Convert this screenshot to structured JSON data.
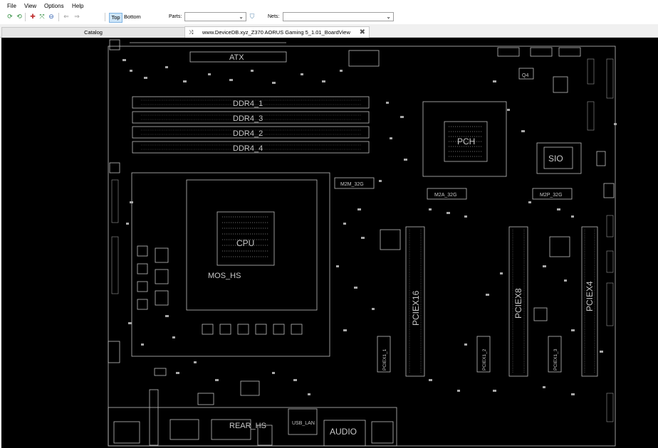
{
  "menu": [
    "File",
    "View",
    "Options",
    "Help"
  ],
  "toolbar": {
    "icons": [
      "refresh-icon",
      "expand-icon",
      "zoom-in-icon",
      "fit-icon",
      "zoom-out-icon",
      "back-arrow-icon",
      "forward-arrow-icon"
    ],
    "top_label": "Top",
    "bottom_label": "Bottom",
    "parts_label": "Parts:",
    "nets_label": "Nets:",
    "parts_value": "",
    "nets_value": ""
  },
  "tabs": {
    "catalog": "Catalog",
    "document": "www.DeviceDB.xyz_Z370 AORUS Gaming 5_1.01_BoardView"
  },
  "board": {
    "labels": {
      "atx": "ATX",
      "ddr1": "DDR4_1",
      "ddr3": "DDR4_3",
      "ddr2": "DDR4_2",
      "ddr4": "DDR4_4",
      "m2m": "M2M_32G",
      "m2a": "M2A_32G",
      "m2p": "M2P_32G",
      "sio": "SIO",
      "pch": "PCH",
      "mos": "MOS_HS",
      "cpu": "CPU",
      "pciex16": "PCIEX16",
      "pciex8": "PCIEX8",
      "pciex4": "PCIEX4",
      "pciex1_1": "PCIEX1_1",
      "pciex1_2": "PCIEX1_2",
      "pciex1_3": "PCIEX1_3",
      "rear_hs": "REAR_HS",
      "audio": "AUDIO",
      "usb_lan": "USB_LAN",
      "q4": "Q4"
    }
  }
}
